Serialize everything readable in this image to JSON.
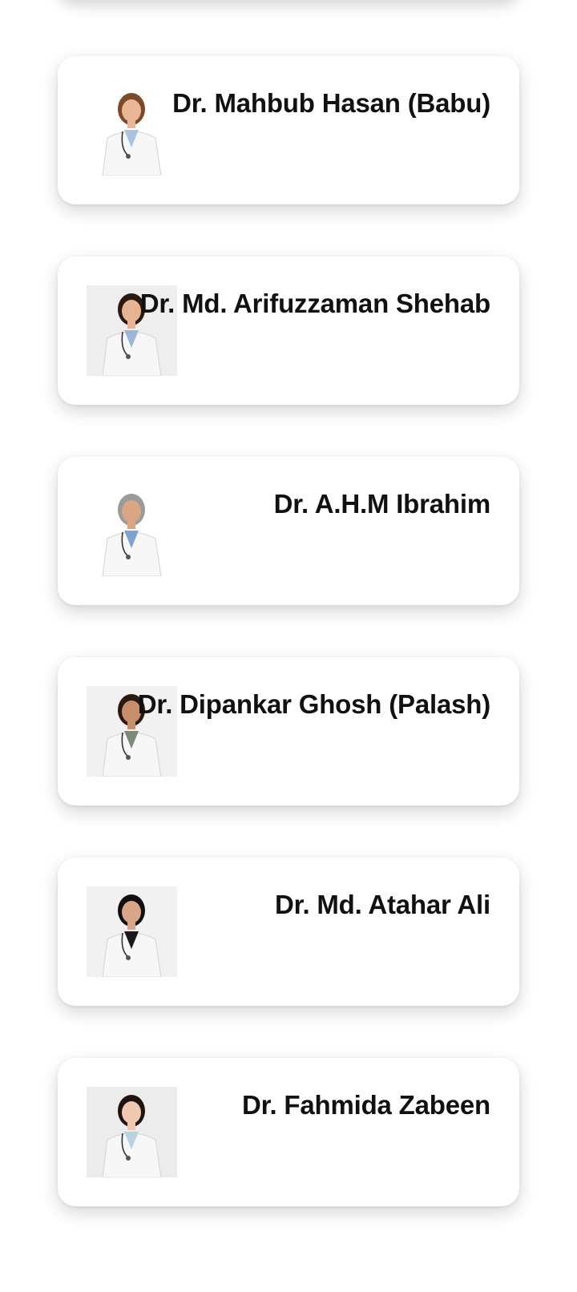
{
  "doctors": [
    {
      "name": "Dr. Mahbub Hasan (Babu)",
      "photo": "doctor-photo-female-smiling",
      "bg": "#ffffff",
      "hair": "#7a4a2a",
      "skin": "#e8b896",
      "shirt": "#a9c4e0"
    },
    {
      "name": "Dr. Md. Arifuzzaman Shehab",
      "photo": "doctor-photo-female-arms-crossed",
      "bg": "#eeeeee",
      "hair": "#2a1a12",
      "skin": "#e6b493",
      "shirt": "#9ab7d6"
    },
    {
      "name": "Dr. A.H.M Ibrahim",
      "photo": "doctor-photo-male-clipboard",
      "bg": "#ffffff",
      "hair": "#9a9a9a",
      "skin": "#d9a583",
      "shirt": "#7fa3d1"
    },
    {
      "name": "Dr. Dipankar Ghosh (Palash)",
      "photo": "doctor-photo-female-long-hair",
      "bg": "#f1f1f1",
      "hair": "#2b1a10",
      "skin": "#c98e6b",
      "shirt": "#7c8a7a"
    },
    {
      "name": "Dr. Md. Atahar Ali",
      "photo": "doctor-photo-female-hijab",
      "bg": "#f1f1f1",
      "hair": "#111111",
      "skin": "#d8a586",
      "shirt": "#1a1a1a"
    },
    {
      "name": "Dr. Fahmida Zabeen",
      "photo": "doctor-photo-female-young",
      "bg": "#ececec",
      "hair": "#1e1410",
      "skin": "#f0c8ae",
      "shirt": "#b8d3df"
    }
  ]
}
